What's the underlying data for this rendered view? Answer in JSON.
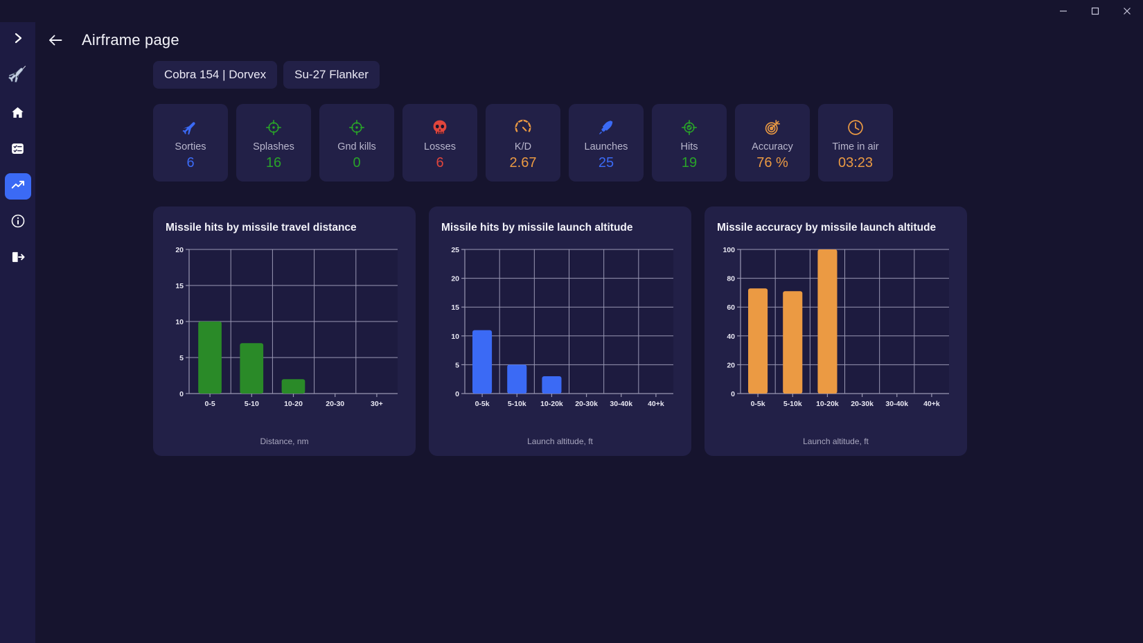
{
  "window": {
    "minimize_label": "Minimize",
    "maximize_label": "Maximize",
    "close_label": "Close"
  },
  "sidebar": {
    "items": [
      {
        "icon": "chevron-right-icon",
        "label": "Expand menu"
      },
      {
        "icon": "fighter-jet-logo-icon",
        "label": "App logo"
      },
      {
        "icon": "home-icon",
        "label": "Home"
      },
      {
        "icon": "list-checks-icon",
        "label": "Missions"
      },
      {
        "icon": "trending-up-icon",
        "label": "Statistics"
      },
      {
        "icon": "info-circle-icon",
        "label": "About"
      },
      {
        "icon": "logout-icon",
        "label": "Log out"
      }
    ],
    "active_index": 4
  },
  "header": {
    "back_label": "Back",
    "title": "Airframe page"
  },
  "tabs": [
    {
      "label": "Cobra 154 | Dorvex"
    },
    {
      "label": "Su-27 Flanker"
    }
  ],
  "colors": {
    "blue": "#3b6af5",
    "green": "#2a8a28",
    "red": "#e0453c",
    "orange": "#eb9a43",
    "page_bg": "#16142e",
    "card_bg": "#222047",
    "sidebar_bg": "#1d1b42",
    "plot_bg": "#1d1b3f",
    "grid": "#9a98b4",
    "label": "#b9b7cd"
  },
  "stats": [
    {
      "icon": "fighter-jet-icon",
      "label": "Sorties",
      "value": "6",
      "color": "#3b6af5"
    },
    {
      "icon": "crosshair-icon",
      "label": "Splashes",
      "value": "16",
      "color": "#29a329"
    },
    {
      "icon": "crosshair-icon",
      "label": "Gnd kills",
      "value": "0",
      "color": "#29a329"
    },
    {
      "icon": "skull-icon",
      "label": "Losses",
      "value": "6",
      "color": "#e0453c"
    },
    {
      "icon": "gauge-icon",
      "label": "K/D",
      "value": "2.67",
      "color": "#eb9a43"
    },
    {
      "icon": "missile-icon",
      "label": "Launches",
      "value": "25",
      "color": "#3b6af5"
    },
    {
      "icon": "target-check-icon",
      "label": "Hits",
      "value": "19",
      "color": "#29a329"
    },
    {
      "icon": "dartboard-icon",
      "label": "Accuracy",
      "value": "76 %",
      "color": "#eb9a43"
    },
    {
      "icon": "clock-icon",
      "label": "Time in air",
      "value": "03:23",
      "color": "#eb9a43"
    }
  ],
  "chart_data": [
    {
      "type": "bar",
      "title": "Missile hits by missile travel distance",
      "categories": [
        "0-5",
        "5-10",
        "10-20",
        "20-30",
        "30+"
      ],
      "values": [
        10,
        7,
        2,
        0,
        0
      ],
      "xlabel": "Distance, nm",
      "ylabel": "",
      "ylim": [
        0,
        20
      ],
      "yticks": [
        0,
        5,
        10,
        15,
        20
      ],
      "color": "#2a8a28",
      "grid": true,
      "legend": "none"
    },
    {
      "type": "bar",
      "title": "Missile hits by missile launch altitude",
      "categories": [
        "0-5k",
        "5-10k",
        "10-20k",
        "20-30k",
        "30-40k",
        "40+k"
      ],
      "values": [
        11,
        5,
        3,
        0,
        0,
        0
      ],
      "xlabel": "Launch altitude, ft",
      "ylabel": "",
      "ylim": [
        0,
        25
      ],
      "yticks": [
        0,
        5,
        10,
        15,
        20,
        25
      ],
      "color": "#3b6af5",
      "grid": true,
      "legend": "none"
    },
    {
      "type": "bar",
      "title": "Missile accuracy by missile launch altitude",
      "categories": [
        "0-5k",
        "5-10k",
        "10-20k",
        "20-30k",
        "30-40k",
        "40+k"
      ],
      "values": [
        73,
        71,
        100,
        0,
        0,
        0
      ],
      "xlabel": "Launch altitude, ft",
      "ylabel": "",
      "ylim": [
        0,
        100
      ],
      "yticks": [
        0,
        20,
        40,
        60,
        80,
        100
      ],
      "color": "#eb9a43",
      "grid": true,
      "legend": "none"
    }
  ]
}
